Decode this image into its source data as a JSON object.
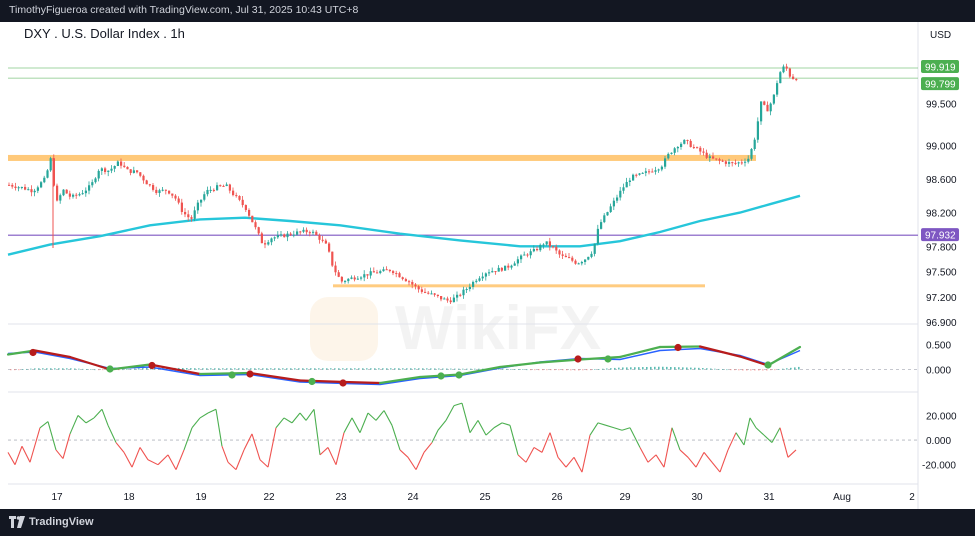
{
  "header": {
    "credit": "TimothyFigueroa created with TradingView.com, Jul 31, 2025 10:43 UTC+8"
  },
  "footer": {
    "brand": "TradingView"
  },
  "watermark": {
    "text": "WikiFX"
  },
  "colors": {
    "candle_up": "#26a69a",
    "candle_down": "#ef5350",
    "ma": "#26c6da",
    "resistance": "#ffb74d",
    "support": "#ffcc80",
    "level_purple": "#7e57c2",
    "last_price": "#4caf50",
    "macd_fast": "#2962ff",
    "macd_signal_up": "#4caf50",
    "macd_signal_down": "#b71c1c",
    "osc_up": "#4caf50",
    "osc_down": "#ef5350"
  },
  "chart_data": {
    "type": "candlestick",
    "title": "DXY . U.S. Dollar Index . 1h",
    "currency": "USD",
    "x_axis": {
      "labels": [
        "17",
        "18",
        "19",
        "22",
        "23",
        "24",
        "25",
        "26",
        "29",
        "30",
        "31",
        "Aug",
        "2"
      ]
    },
    "price_axis": {
      "range": [
        96.9,
        100.05
      ],
      "ticks": [
        "99.500",
        "99.000",
        "98.600",
        "98.200",
        "97.800",
        "97.500",
        "97.200",
        "96.900"
      ],
      "badges": [
        {
          "label": "99.919",
          "value": 99.919,
          "color": "#4caf50"
        },
        {
          "label": "99.799",
          "value": 99.799,
          "color": "#4caf50"
        },
        {
          "label": "97.932",
          "value": 97.932,
          "color": "#7e57c2"
        }
      ]
    },
    "levels": [
      {
        "name": "resistance",
        "value": 98.85,
        "x_from": 0,
        "x_to": 748
      },
      {
        "name": "support",
        "value": 97.33,
        "x_from": 333,
        "x_to": 705
      },
      {
        "name": "purple-level",
        "value": 97.932
      },
      {
        "name": "last-price-line",
        "value": 99.919
      },
      {
        "name": "current-price-line",
        "value": 99.799
      }
    ],
    "price_path": [
      [
        8,
        98.53
      ],
      [
        20,
        98.5
      ],
      [
        32,
        98.46
      ],
      [
        44,
        98.6
      ],
      [
        50,
        98.85
      ],
      [
        55,
        98.3
      ],
      [
        62,
        98.47
      ],
      [
        70,
        98.38
      ],
      [
        80,
        98.43
      ],
      [
        90,
        98.52
      ],
      [
        98,
        98.72
      ],
      [
        108,
        98.7
      ],
      [
        118,
        98.8
      ],
      [
        126,
        98.7
      ],
      [
        136,
        98.68
      ],
      [
        146,
        98.55
      ],
      [
        156,
        98.45
      ],
      [
        166,
        98.47
      ],
      [
        174,
        98.38
      ],
      [
        182,
        98.2
      ],
      [
        190,
        98.12
      ],
      [
        197,
        98.3
      ],
      [
        205,
        98.45
      ],
      [
        215,
        98.5
      ],
      [
        225,
        98.52
      ],
      [
        235,
        98.38
      ],
      [
        245,
        98.25
      ],
      [
        255,
        98.0
      ],
      [
        262,
        97.82
      ],
      [
        270,
        97.9
      ],
      [
        280,
        97.92
      ],
      [
        290,
        97.95
      ],
      [
        300,
        97.97
      ],
      [
        310,
        97.98
      ],
      [
        318,
        97.9
      ],
      [
        326,
        97.8
      ],
      [
        332,
        97.55
      ],
      [
        340,
        97.38
      ],
      [
        350,
        97.42
      ],
      [
        360,
        97.45
      ],
      [
        370,
        97.48
      ],
      [
        380,
        97.5
      ],
      [
        390,
        97.52
      ],
      [
        400,
        97.44
      ],
      [
        408,
        97.38
      ],
      [
        416,
        97.3
      ],
      [
        424,
        97.25
      ],
      [
        432,
        97.22
      ],
      [
        440,
        97.18
      ],
      [
        448,
        97.15
      ],
      [
        456,
        97.2
      ],
      [
        466,
        97.3
      ],
      [
        476,
        97.42
      ],
      [
        486,
        97.5
      ],
      [
        496,
        97.52
      ],
      [
        506,
        97.55
      ],
      [
        514,
        97.62
      ],
      [
        524,
        97.7
      ],
      [
        534,
        97.75
      ],
      [
        544,
        97.85
      ],
      [
        552,
        97.78
      ],
      [
        560,
        97.68
      ],
      [
        568,
        97.65
      ],
      [
        576,
        97.6
      ],
      [
        584,
        97.65
      ],
      [
        592,
        97.75
      ],
      [
        598,
        98.05
      ],
      [
        606,
        98.2
      ],
      [
        614,
        98.35
      ],
      [
        622,
        98.5
      ],
      [
        630,
        98.62
      ],
      [
        640,
        98.65
      ],
      [
        650,
        98.7
      ],
      [
        660,
        98.75
      ],
      [
        668,
        98.9
      ],
      [
        676,
        99.0
      ],
      [
        684,
        99.05
      ],
      [
        692,
        98.98
      ],
      [
        700,
        98.92
      ],
      [
        708,
        98.85
      ],
      [
        716,
        98.82
      ],
      [
        724,
        98.8
      ],
      [
        732,
        98.78
      ],
      [
        740,
        98.8
      ],
      [
        748,
        98.85
      ],
      [
        754,
        99.1
      ],
      [
        760,
        99.5
      ],
      [
        766,
        99.42
      ],
      [
        772,
        99.55
      ],
      [
        778,
        99.85
      ],
      [
        784,
        99.95
      ],
      [
        790,
        99.8
      ],
      [
        796,
        99.8
      ]
    ],
    "moving_average": {
      "name": "MA",
      "path": [
        [
          8,
          97.7
        ],
        [
          50,
          97.82
        ],
        [
          100,
          97.92
        ],
        [
          150,
          98.05
        ],
        [
          200,
          98.12
        ],
        [
          245,
          98.14
        ],
        [
          290,
          98.1
        ],
        [
          340,
          98.05
        ],
        [
          400,
          97.95
        ],
        [
          460,
          97.87
        ],
        [
          520,
          97.8
        ],
        [
          580,
          97.8
        ],
        [
          620,
          97.86
        ],
        [
          660,
          97.97
        ],
        [
          700,
          98.1
        ],
        [
          740,
          98.2
        ],
        [
          770,
          98.3
        ],
        [
          800,
          98.4
        ]
      ]
    },
    "macd": {
      "range": [
        -0.35,
        0.85
      ],
      "ticks": [
        "0.500",
        "0.000"
      ],
      "fast": [
        [
          8,
          0.32
        ],
        [
          35,
          0.35
        ],
        [
          70,
          0.22
        ],
        [
          110,
          0.02
        ],
        [
          150,
          0.05
        ],
        [
          200,
          -0.12
        ],
        [
          250,
          -0.1
        ],
        [
          300,
          -0.25
        ],
        [
          345,
          -0.28
        ],
        [
          380,
          -0.3
        ],
        [
          420,
          -0.18
        ],
        [
          460,
          -0.12
        ],
        [
          500,
          0.03
        ],
        [
          540,
          0.15
        ],
        [
          580,
          0.22
        ],
        [
          620,
          0.2
        ],
        [
          660,
          0.38
        ],
        [
          700,
          0.42
        ],
        [
          740,
          0.28
        ],
        [
          768,
          0.1
        ],
        [
          800,
          0.38
        ]
      ],
      "signal": [
        [
          8,
          0.3
        ],
        [
          35,
          0.38
        ],
        [
          70,
          0.25
        ],
        [
          110,
          0.0
        ],
        [
          150,
          0.1
        ],
        [
          200,
          -0.09
        ],
        [
          250,
          -0.07
        ],
        [
          300,
          -0.22
        ],
        [
          345,
          -0.25
        ],
        [
          380,
          -0.27
        ],
        [
          420,
          -0.15
        ],
        [
          460,
          -0.1
        ],
        [
          500,
          0.05
        ],
        [
          540,
          0.14
        ],
        [
          580,
          0.2
        ],
        [
          620,
          0.25
        ],
        [
          660,
          0.45
        ],
        [
          700,
          0.46
        ],
        [
          740,
          0.26
        ],
        [
          768,
          0.08
        ],
        [
          800,
          0.45
        ]
      ],
      "cross_points": [
        [
          33,
          0.34,
          "down"
        ],
        [
          110,
          0.01,
          "up"
        ],
        [
          152,
          0.08,
          "down"
        ],
        [
          232,
          -0.11,
          "up"
        ],
        [
          250,
          -0.09,
          "down"
        ],
        [
          312,
          -0.24,
          "up"
        ],
        [
          343,
          -0.27,
          "down"
        ],
        [
          441,
          -0.13,
          "up"
        ],
        [
          459,
          -0.11,
          "up"
        ],
        [
          578,
          0.21,
          "down"
        ],
        [
          608,
          0.21,
          "up"
        ],
        [
          678,
          0.44,
          "down"
        ],
        [
          768,
          0.09,
          "up"
        ]
      ],
      "hist_step": 4
    },
    "oscillator": {
      "range": [
        -30,
        35
      ],
      "ticks": [
        "20.000",
        "0.000",
        "-20.000"
      ],
      "series": [
        [
          8,
          -10
        ],
        [
          15,
          -20
        ],
        [
          22,
          -5
        ],
        [
          30,
          -18
        ],
        [
          40,
          10
        ],
        [
          48,
          15
        ],
        [
          56,
          -8
        ],
        [
          63,
          -15
        ],
        [
          70,
          5
        ],
        [
          78,
          20
        ],
        [
          86,
          14
        ],
        [
          94,
          18
        ],
        [
          102,
          25
        ],
        [
          108,
          12
        ],
        [
          116,
          -2
        ],
        [
          124,
          -10
        ],
        [
          132,
          -22
        ],
        [
          140,
          -6
        ],
        [
          148,
          -16
        ],
        [
          158,
          -20
        ],
        [
          168,
          -12
        ],
        [
          176,
          -24
        ],
        [
          184,
          -8
        ],
        [
          192,
          10
        ],
        [
          200,
          18
        ],
        [
          208,
          22
        ],
        [
          216,
          25
        ],
        [
          222,
          -5
        ],
        [
          228,
          -18
        ],
        [
          236,
          -24
        ],
        [
          244,
          -8
        ],
        [
          252,
          5
        ],
        [
          260,
          -16
        ],
        [
          268,
          -22
        ],
        [
          276,
          10
        ],
        [
          284,
          18
        ],
        [
          292,
          14
        ],
        [
          300,
          22
        ],
        [
          306,
          16
        ],
        [
          314,
          25
        ],
        [
          320,
          -12
        ],
        [
          328,
          -6
        ],
        [
          336,
          -20
        ],
        [
          344,
          6
        ],
        [
          352,
          18
        ],
        [
          360,
          6
        ],
        [
          368,
          22
        ],
        [
          376,
          16
        ],
        [
          384,
          24
        ],
        [
          392,
          12
        ],
        [
          400,
          -8
        ],
        [
          408,
          -14
        ],
        [
          416,
          -24
        ],
        [
          424,
          -10
        ],
        [
          432,
          -2
        ],
        [
          438,
          8
        ],
        [
          446,
          16
        ],
        [
          454,
          28
        ],
        [
          462,
          30
        ],
        [
          470,
          6
        ],
        [
          478,
          16
        ],
        [
          486,
          4
        ],
        [
          494,
          10
        ],
        [
          502,
          14
        ],
        [
          510,
          12
        ],
        [
          518,
          -12
        ],
        [
          526,
          -18
        ],
        [
          534,
          -6
        ],
        [
          542,
          -10
        ],
        [
          550,
          6
        ],
        [
          558,
          -14
        ],
        [
          566,
          -22
        ],
        [
          574,
          -14
        ],
        [
          582,
          -26
        ],
        [
          590,
          4
        ],
        [
          598,
          14
        ],
        [
          606,
          12
        ],
        [
          614,
          10
        ],
        [
          622,
          8
        ],
        [
          630,
          10
        ],
        [
          640,
          -6
        ],
        [
          648,
          -18
        ],
        [
          656,
          -12
        ],
        [
          664,
          -22
        ],
        [
          672,
          10
        ],
        [
          680,
          -8
        ],
        [
          688,
          -14
        ],
        [
          696,
          -22
        ],
        [
          704,
          -10
        ],
        [
          712,
          -18
        ],
        [
          720,
          -26
        ],
        [
          728,
          -8
        ],
        [
          736,
          6
        ],
        [
          744,
          -4
        ],
        [
          750,
          18
        ],
        [
          756,
          10
        ],
        [
          764,
          4
        ],
        [
          772,
          -2
        ],
        [
          780,
          10
        ],
        [
          788,
          -14
        ],
        [
          796,
          -8
        ]
      ]
    }
  }
}
